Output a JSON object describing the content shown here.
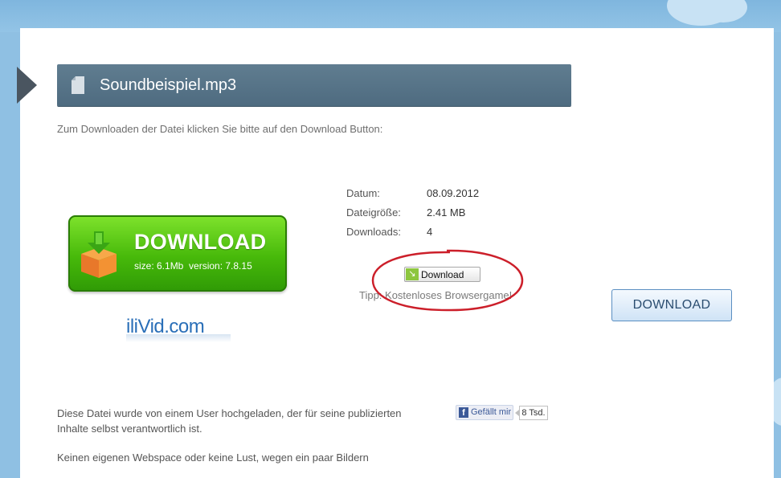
{
  "colors": {
    "sky": "#8fc0e3",
    "title_bar": "#587689",
    "ad_green": "#47b90a",
    "highlight_red": "#cc1f2a",
    "facebook": "#3b5998"
  },
  "header": {
    "file_name": "Soundbeispiel.mp3",
    "icon": "file-icon"
  },
  "instruction": "Zum Downloaden der Datei klicken Sie bitte auf den Download Button:",
  "ad": {
    "title": "DOWNLOAD",
    "subtitle": "size: 6.1Mb  version: 7.8.15",
    "brand_prefix": "iliVid",
    "brand_suffix": ".com",
    "icon": "download-box-icon"
  },
  "file_info": [
    {
      "label": "Datum:",
      "value": "08.09.2012"
    },
    {
      "label": "Dateigröße:",
      "value": "2.41 MB"
    },
    {
      "label": "Downloads:",
      "value": "4"
    }
  ],
  "download_button": {
    "label": "Download",
    "icon": "download-arrow-icon"
  },
  "tip": "Tipp: Kostenloses Browsergame!",
  "download_button_large": "DOWNLOAD",
  "notice": "Diese Datei wurde von einem User hochgeladen, der für seine publizierten Inhalte selbst verantwortlich ist.",
  "notice_second": "Keinen eigenen Webspace oder keine Lust, wegen ein paar Bildern",
  "facebook": {
    "like_label": "Gefällt mir",
    "count": "8 Tsd.",
    "icon": "facebook-icon"
  }
}
